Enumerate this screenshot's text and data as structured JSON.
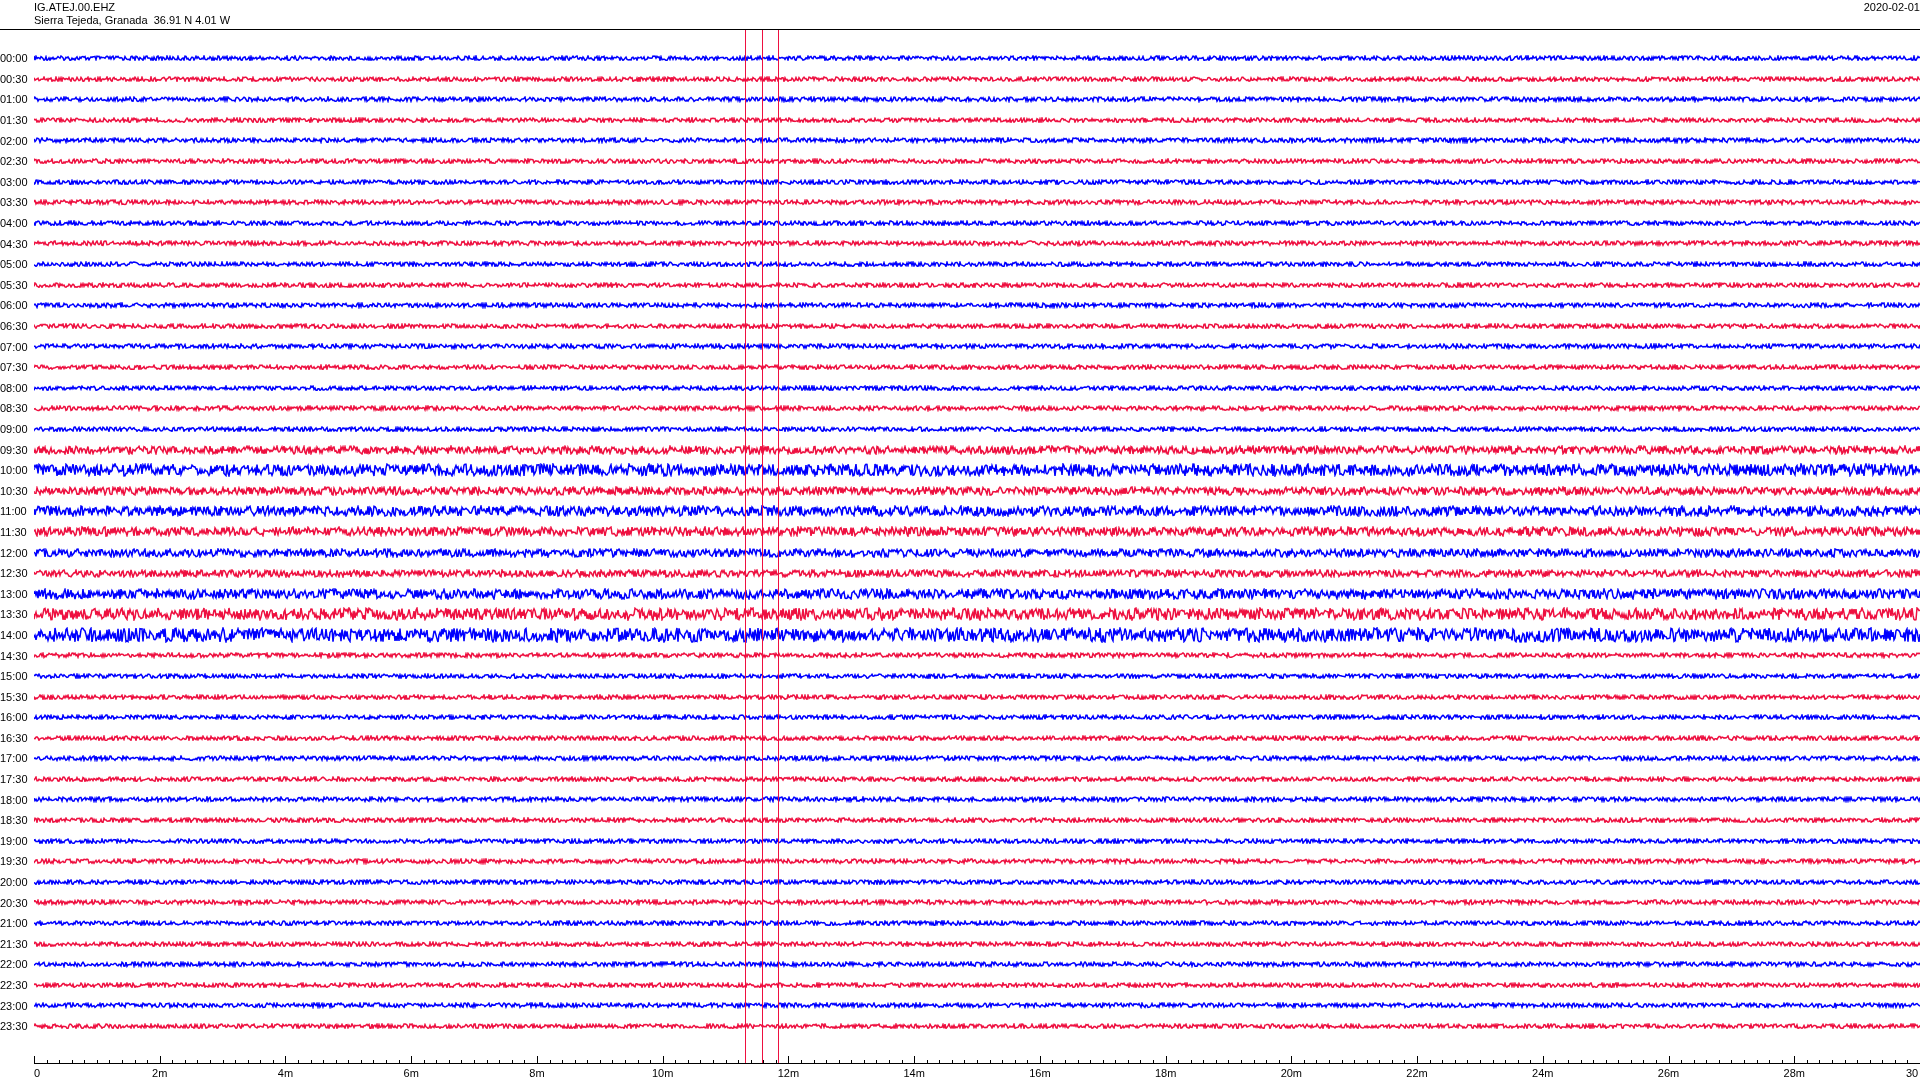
{
  "header": {
    "station": "IG.ATEJ.00.EHZ",
    "location": "Sierra Tejeda, Granada  36.91 N 4.01 W",
    "date": "2020-02-01"
  },
  "rows": [
    {
      "time": "00:00",
      "color": "#0000ff"
    },
    {
      "time": "00:30",
      "color": "#ee1040"
    },
    {
      "time": "01:00",
      "color": "#0000ff"
    },
    {
      "time": "01:30",
      "color": "#ee1040"
    },
    {
      "time": "02:00",
      "color": "#0000ff"
    },
    {
      "time": "02:30",
      "color": "#ee1040"
    },
    {
      "time": "03:00",
      "color": "#0000ff"
    },
    {
      "time": "03:30",
      "color": "#ee1040"
    },
    {
      "time": "04:00",
      "color": "#0000ff"
    },
    {
      "time": "04:30",
      "color": "#ee1040"
    },
    {
      "time": "05:00",
      "color": "#0000ff"
    },
    {
      "time": "05:30",
      "color": "#ee1040"
    },
    {
      "time": "06:00",
      "color": "#0000ff"
    },
    {
      "time": "06:30",
      "color": "#ee1040"
    },
    {
      "time": "07:00",
      "color": "#0000ff"
    },
    {
      "time": "07:30",
      "color": "#ee1040"
    },
    {
      "time": "08:00",
      "color": "#0000ff"
    },
    {
      "time": "08:30",
      "color": "#ee1040"
    },
    {
      "time": "09:00",
      "color": "#0000ff"
    },
    {
      "time": "09:30",
      "color": "#ee1040"
    },
    {
      "time": "10:00",
      "color": "#0000ff"
    },
    {
      "time": "10:30",
      "color": "#ee1040"
    },
    {
      "time": "11:00",
      "color": "#0000ff"
    },
    {
      "time": "11:30",
      "color": "#ee1040"
    },
    {
      "time": "12:00",
      "color": "#0000ff"
    },
    {
      "time": "12:30",
      "color": "#ee1040"
    },
    {
      "time": "13:00",
      "color": "#0000ff"
    },
    {
      "time": "13:30",
      "color": "#ee1040"
    },
    {
      "time": "14:00",
      "color": "#0000ff"
    },
    {
      "time": "14:30",
      "color": "#ee1040"
    },
    {
      "time": "15:00",
      "color": "#0000ff"
    },
    {
      "time": "15:30",
      "color": "#ee1040"
    },
    {
      "time": "16:00",
      "color": "#0000ff"
    },
    {
      "time": "16:30",
      "color": "#ee1040"
    },
    {
      "time": "17:00",
      "color": "#0000ff"
    },
    {
      "time": "17:30",
      "color": "#ee1040"
    },
    {
      "time": "18:00",
      "color": "#0000ff"
    },
    {
      "time": "18:30",
      "color": "#ee1040"
    },
    {
      "time": "19:00",
      "color": "#0000ff"
    },
    {
      "time": "19:30",
      "color": "#ee1040"
    },
    {
      "time": "20:00",
      "color": "#0000ff"
    },
    {
      "time": "20:30",
      "color": "#ee1040"
    },
    {
      "time": "21:00",
      "color": "#0000ff"
    },
    {
      "time": "21:30",
      "color": "#ee1040"
    },
    {
      "time": "22:00",
      "color": "#0000ff"
    },
    {
      "time": "22:30",
      "color": "#ee1040"
    },
    {
      "time": "23:00",
      "color": "#0000ff"
    },
    {
      "time": "23:30",
      "color": "#ee1040"
    }
  ],
  "x_axis": {
    "labels": [
      "0",
      "2m",
      "4m",
      "6m",
      "8m",
      "10m",
      "12m",
      "14m",
      "16m",
      "18m",
      "20m",
      "22m",
      "24m",
      "26m",
      "28m",
      "30"
    ]
  }
}
